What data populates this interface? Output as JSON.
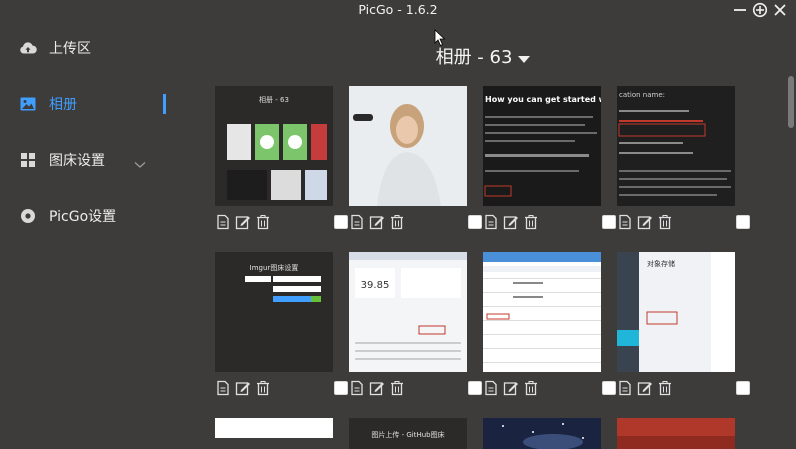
{
  "window": {
    "title": "PicGo - 1.6.2"
  },
  "sidebar": {
    "items": [
      {
        "label": "上传区",
        "icon": "cloud-upload-icon"
      },
      {
        "label": "相册",
        "icon": "image-icon",
        "active": true
      },
      {
        "label": "图床设置",
        "icon": "grid-icon"
      },
      {
        "label": "PicGo设置",
        "icon": "gear-icon"
      }
    ]
  },
  "gallery": {
    "title": "相册 - 63",
    "thumbnails": [
      {
        "kind": "picgo-screenshot",
        "text": "相册 - 63"
      },
      {
        "kind": "photo-woman"
      },
      {
        "kind": "docs-dark",
        "text": "How you can get started with the"
      },
      {
        "kind": "docs-dark2",
        "text": "cation name:"
      },
      {
        "kind": "picgo-imgur",
        "text": "Imgur图床设置"
      },
      {
        "kind": "dashboard",
        "text": "39.85"
      },
      {
        "kind": "table-page"
      },
      {
        "kind": "object-storage",
        "text": "对象存储"
      },
      {
        "kind": "white-blank"
      },
      {
        "kind": "picgo-github",
        "text": "图片上传 - GitHub图床"
      },
      {
        "kind": "space-photo"
      },
      {
        "kind": "red-photo"
      }
    ]
  },
  "colors": {
    "background": "#3d3c3b",
    "accent": "#409eff",
    "checkbox": "#ffffff"
  }
}
